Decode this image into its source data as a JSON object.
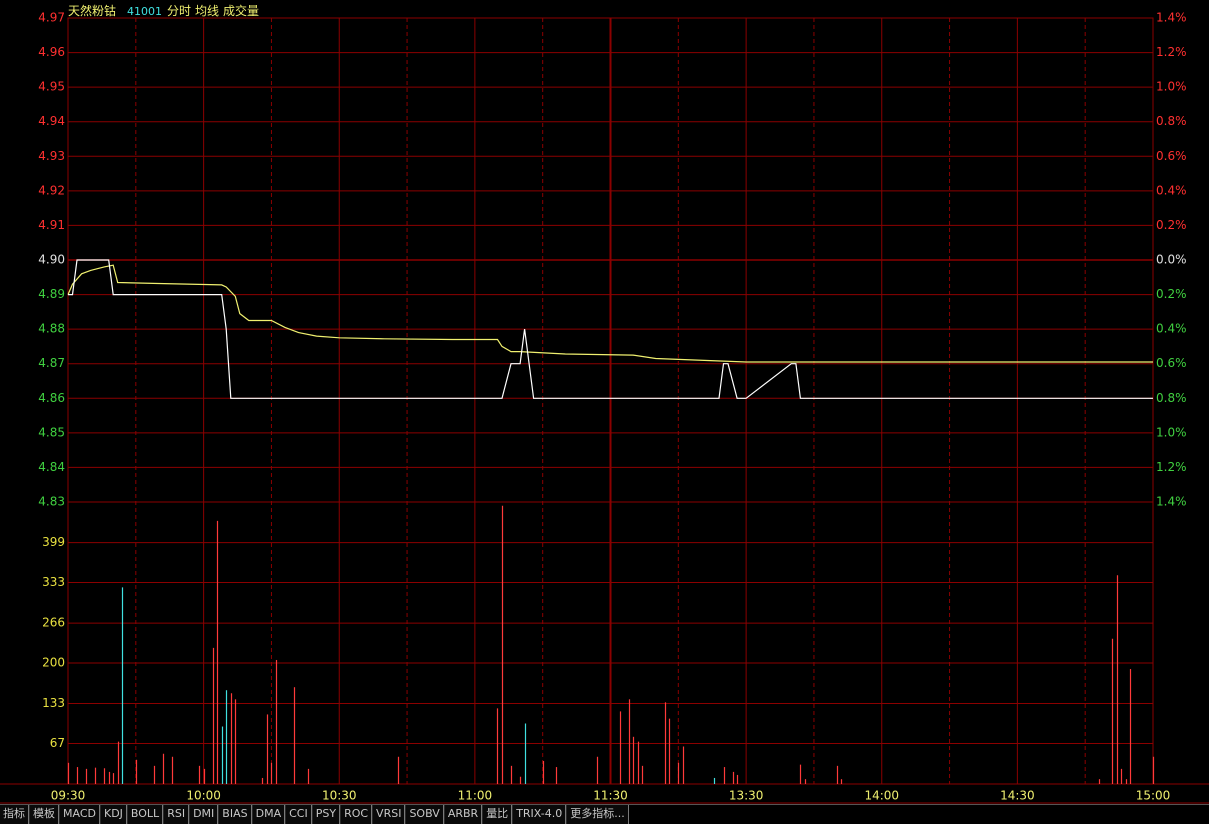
{
  "header": {
    "stock_name": "天然粉钴",
    "stock_code": "41001",
    "legend_items": [
      "分时",
      "均线",
      "成交量"
    ]
  },
  "colors": {
    "background": "#000000",
    "grid": "#8b0000",
    "price_up": "#ff3030",
    "price_down": "#40d040",
    "neutral": "#e0e0e0",
    "volume_axis": "#e8e040",
    "price_line": "#ffffff",
    "avg_line": "#f0f070",
    "volume_up": "#ff3a3a",
    "volume_down": "#40e0e0",
    "stock_name": "#f0f070",
    "stock_code": "#40e0e0",
    "time_label": "#f0f070"
  },
  "tabs": [
    "指标",
    "模板",
    "MACD",
    "KDJ",
    "BOLL",
    "RSI",
    "DMI",
    "BIAS",
    "DMA",
    "CCI",
    "PSY",
    "ROC",
    "VRSI",
    "SOBV",
    "ARBR",
    "量比",
    "TRIX-4.0",
    "更多指标..."
  ],
  "chart_data": [
    {
      "type": "line",
      "title": "",
      "prev_close": 4.9,
      "y_ticks": [
        "4.97",
        "4.96",
        "4.95",
        "4.94",
        "4.93",
        "4.92",
        "4.91",
        "4.90",
        "4.89",
        "4.88",
        "4.87",
        "4.86",
        "4.85",
        "4.84",
        "4.83"
      ],
      "y_ticks_right": [
        "1.4%",
        "1.2%",
        "1.0%",
        "0.8%",
        "0.6%",
        "0.4%",
        "0.2%",
        "0.0%",
        "0.2%",
        "0.4%",
        "0.6%",
        "0.8%",
        "1.0%",
        "1.2%",
        "1.4%"
      ],
      "ylim": [
        4.83,
        4.97
      ],
      "x_ticks": [
        "09:30",
        "10:00",
        "10:30",
        "11:00",
        "11:30",
        "13:30",
        "14:00",
        "14:30",
        "15:00"
      ],
      "x_range_minutes": [
        0,
        240
      ],
      "series": [
        {
          "key": "price",
          "x": [
            0,
            1,
            2,
            9,
            10,
            34,
            35,
            36,
            44,
            95,
            96,
            98,
            100,
            101,
            102,
            103,
            143,
            144,
            145,
            146,
            148,
            149,
            150,
            160,
            161,
            162,
            240
          ],
          "y": [
            4.89,
            4.89,
            4.9,
            4.9,
            4.89,
            4.89,
            4.88,
            4.86,
            4.86,
            4.86,
            4.86,
            4.87,
            4.87,
            4.88,
            4.87,
            4.86,
            4.86,
            4.86,
            4.87,
            4.87,
            4.86,
            4.86,
            4.86,
            4.87,
            4.87,
            4.86,
            4.86
          ]
        },
        {
          "key": "average",
          "x": [
            0,
            1,
            3,
            5,
            8,
            10,
            11,
            20,
            34,
            35,
            37,
            38,
            40,
            45,
            48,
            51,
            55,
            60,
            70,
            85,
            95,
            96,
            98,
            100,
            110,
            125,
            130,
            150,
            240
          ],
          "y": [
            4.89,
            4.893,
            4.896,
            4.897,
            4.898,
            4.8985,
            4.8935,
            4.8932,
            4.8928,
            4.8922,
            4.8895,
            4.8845,
            4.8825,
            4.8825,
            4.8805,
            4.879,
            4.878,
            4.8775,
            4.8772,
            4.877,
            4.877,
            4.875,
            4.8735,
            4.8735,
            4.8728,
            4.8725,
            4.8715,
            4.8705,
            4.8705
          ]
        }
      ]
    },
    {
      "type": "bar",
      "title": "",
      "y_ticks": [
        "399",
        "333",
        "266",
        "200",
        "133",
        "67"
      ],
      "ylim": [
        0,
        466
      ],
      "x_range_minutes": [
        0,
        240
      ],
      "bars": [
        {
          "x": 0,
          "v": 35,
          "dir": "up"
        },
        {
          "x": 2,
          "v": 28,
          "dir": "up"
        },
        {
          "x": 4,
          "v": 25,
          "dir": "up"
        },
        {
          "x": 6,
          "v": 27,
          "dir": "up"
        },
        {
          "x": 8,
          "v": 26,
          "dir": "up"
        },
        {
          "x": 9,
          "v": 20,
          "dir": "up"
        },
        {
          "x": 10,
          "v": 18,
          "dir": "up"
        },
        {
          "x": 11,
          "v": 70,
          "dir": "up"
        },
        {
          "x": 12,
          "v": 325,
          "dir": "down"
        },
        {
          "x": 15,
          "v": 40,
          "dir": "up"
        },
        {
          "x": 19,
          "v": 30,
          "dir": "up"
        },
        {
          "x": 21,
          "v": 50,
          "dir": "up"
        },
        {
          "x": 23,
          "v": 45,
          "dir": "up"
        },
        {
          "x": 29,
          "v": 30,
          "dir": "up"
        },
        {
          "x": 30,
          "v": 25,
          "dir": "up"
        },
        {
          "x": 32,
          "v": 225,
          "dir": "up"
        },
        {
          "x": 33,
          "v": 435,
          "dir": "up"
        },
        {
          "x": 34,
          "v": 95,
          "dir": "down"
        },
        {
          "x": 35,
          "v": 155,
          "dir": "down"
        },
        {
          "x": 36,
          "v": 150,
          "dir": "up"
        },
        {
          "x": 37,
          "v": 140,
          "dir": "up"
        },
        {
          "x": 43,
          "v": 10,
          "dir": "up"
        },
        {
          "x": 44,
          "v": 115,
          "dir": "up"
        },
        {
          "x": 45,
          "v": 35,
          "dir": "up"
        },
        {
          "x": 46,
          "v": 205,
          "dir": "up"
        },
        {
          "x": 50,
          "v": 160,
          "dir": "up"
        },
        {
          "x": 53,
          "v": 25,
          "dir": "up"
        },
        {
          "x": 73,
          "v": 45,
          "dir": "up"
        },
        {
          "x": 95,
          "v": 125,
          "dir": "up"
        },
        {
          "x": 96,
          "v": 460,
          "dir": "up"
        },
        {
          "x": 98,
          "v": 30,
          "dir": "up"
        },
        {
          "x": 100,
          "v": 12,
          "dir": "up"
        },
        {
          "x": 101,
          "v": 100,
          "dir": "down"
        },
        {
          "x": 105,
          "v": 38,
          "dir": "up"
        },
        {
          "x": 108,
          "v": 28,
          "dir": "up"
        },
        {
          "x": 117,
          "v": 45,
          "dir": "up"
        },
        {
          "x": 122,
          "v": 120,
          "dir": "up"
        },
        {
          "x": 124,
          "v": 140,
          "dir": "up"
        },
        {
          "x": 125,
          "v": 78,
          "dir": "up"
        },
        {
          "x": 126,
          "v": 70,
          "dir": "up"
        },
        {
          "x": 127,
          "v": 30,
          "dir": "up"
        },
        {
          "x": 132,
          "v": 135,
          "dir": "up"
        },
        {
          "x": 133,
          "v": 108,
          "dir": "up"
        },
        {
          "x": 135,
          "v": 35,
          "dir": "up"
        },
        {
          "x": 136,
          "v": 62,
          "dir": "up"
        },
        {
          "x": 143,
          "v": 10,
          "dir": "down"
        },
        {
          "x": 145,
          "v": 28,
          "dir": "up"
        },
        {
          "x": 147,
          "v": 20,
          "dir": "up"
        },
        {
          "x": 148,
          "v": 15,
          "dir": "up"
        },
        {
          "x": 162,
          "v": 32,
          "dir": "up"
        },
        {
          "x": 163,
          "v": 8,
          "dir": "up"
        },
        {
          "x": 170,
          "v": 30,
          "dir": "up"
        },
        {
          "x": 171,
          "v": 8,
          "dir": "up"
        },
        {
          "x": 228,
          "v": 8,
          "dir": "up"
        },
        {
          "x": 231,
          "v": 240,
          "dir": "up"
        },
        {
          "x": 232,
          "v": 345,
          "dir": "up"
        },
        {
          "x": 233,
          "v": 25,
          "dir": "up"
        },
        {
          "x": 234,
          "v": 8,
          "dir": "up"
        },
        {
          "x": 235,
          "v": 190,
          "dir": "up"
        },
        {
          "x": 240,
          "v": 45,
          "dir": "up"
        }
      ]
    }
  ]
}
